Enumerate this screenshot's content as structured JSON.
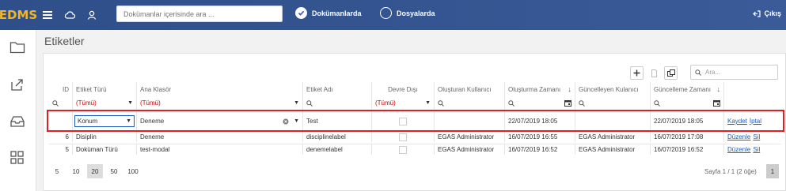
{
  "app": {
    "brand": "EDMS"
  },
  "search": {
    "placeholder": "Dokümanlar içerisinde ara ..."
  },
  "scope": {
    "documents": "Dokümanlarda",
    "folders": "Dosyalarda"
  },
  "logout_label": "Çıkış",
  "page_title": "Etiketler",
  "grid_search_placeholder": "Ara...",
  "columns": [
    "ID",
    "Etiket Türü",
    "Ana Klasör",
    "Etiket Adı",
    "Devre Dışı",
    "Oluşturan Kullanıcı",
    "Oluşturma Zamanı",
    "Güncelleyen Kulanıcı",
    "Güncelleme Zamanı"
  ],
  "filter_all": "(Tümü)",
  "edit_row": {
    "tag_type": "Konum",
    "folder": "Deneme",
    "tag_name": "Test",
    "created": "22/07/2019 18:05",
    "updated": "22/07/2019 18:05",
    "save": "Kaydet",
    "cancel": "İptal"
  },
  "rows": [
    {
      "id": "6",
      "tag_type": "Disiplin",
      "folder": "Deneme",
      "tag_name": "disciplinelabel",
      "created_by": "EGAS Administrator",
      "created": "16/07/2019 16:55",
      "updated_by": "EGAS Administrator",
      "updated": "16/07/2019 17:08",
      "edit": "Düzenle",
      "delete": "Sil"
    },
    {
      "id": "5",
      "tag_type": "Doküman Türü",
      "folder": "test-modal",
      "tag_name": "denemelabel",
      "created_by": "EGAS Administrator",
      "created": "16/07/2019 16:52",
      "updated_by": "EGAS Administrator",
      "updated": "16/07/2019 16:52",
      "edit": "Düzenle",
      "delete": "Sil"
    }
  ],
  "page_sizes": [
    "5",
    "10",
    "20",
    "50",
    "100"
  ],
  "page_size_selected": "20",
  "page_info": "Sayfa 1 / 1 (2 öğe)",
  "current_page": "1"
}
